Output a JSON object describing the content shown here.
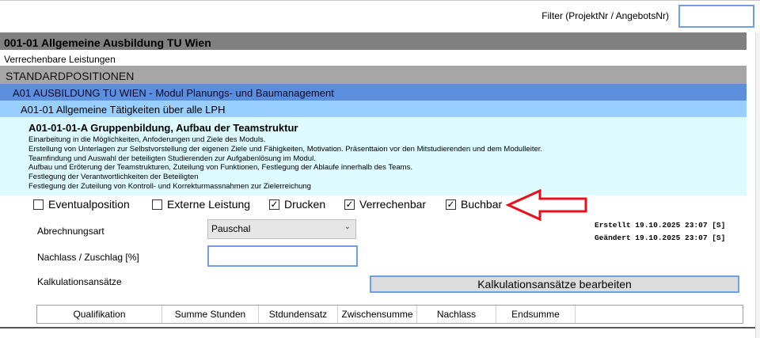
{
  "filter": {
    "label": "Filter (ProjektNr / AngebotsNr)",
    "value": ""
  },
  "sections": {
    "title": "001-01 Allgemeine Ausbildung TU Wien",
    "verrechenbar": "Verrechenbare Leistungen",
    "standard": "STANDARDPOSITIONEN",
    "group": "A01 AUSBILDUNG TU WIEN - Modul Planungs- und Baumanagement",
    "subgroup": "A01-01 Allgemeine Tätigkeiten über alle LPH"
  },
  "item": {
    "title": "A01-01-01-A Gruppenbildung, Aufbau der Teamstruktur",
    "description": [
      "Einarbeitung in die Möglichkeiten, Anfoderungen und Ziele des Moduls.",
      "Erstellung von Unterlagen zur Selbstvorstellung der eigenen Ziele und Fähigkeiten, Motivation. Präsenttaion vor den Mitstudierenden und dem Modulleiter.",
      "Teamfindung und Auswahl der beteiligten Studierenden zur Aufgabenlösung im Modul.",
      "Aufbau und Eröterung der Teamstrukturen, Zuteilung von Funktionen, Festlegung der Ablaufe innerhalb des Teams.",
      "Festlegung der Verantwortlichkeiten der Beteiligten",
      "Festlegung der Zuteilung von Kontroll- und Korrekturmassnahmen zur Zielerreichung"
    ]
  },
  "checkboxes": [
    {
      "label": "Eventualposition",
      "checked": false
    },
    {
      "label": "Externe Leistung",
      "checked": false
    },
    {
      "label": "Drucken",
      "checked": true
    },
    {
      "label": "Verrechenbar",
      "checked": true
    },
    {
      "label": "Buchbar",
      "checked": true
    }
  ],
  "form": {
    "abrechnungsart_label": "Abrechnungsart",
    "abrechnungsart_value": "Pauschal",
    "nachlass_label": "Nachlass / Zuschlag [%]",
    "nachlass_value": "",
    "kalkulation_label": "Kalkulationsansätze",
    "kalkulation_button": "Kalkulationsansätze bearbeiten"
  },
  "meta": {
    "erstellt": "Erstellt   19.10.2025 23:07   [S]",
    "geaendert": "Geändert   19.10.2025 23:07   [S]"
  },
  "table": {
    "columns": [
      "Qualifikation",
      "Summe Stunden",
      "Stdundensatz",
      "Zwischensumme",
      "Nachlass",
      "Endsumme"
    ]
  },
  "colors": {
    "annotation_arrow": "#e8101a",
    "accent_border": "#6f9fe6"
  }
}
